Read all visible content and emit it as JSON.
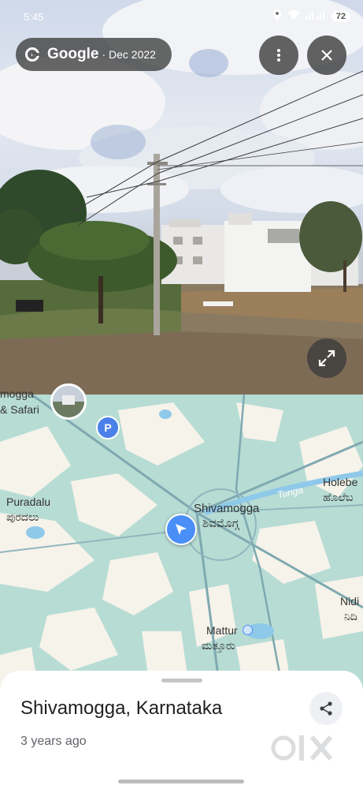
{
  "status_bar": {
    "time": "5:45",
    "battery": "72"
  },
  "street_view": {
    "brand": "Google",
    "date": "· Dec 2022",
    "more_icon": "more-vert-icon",
    "close_icon": "close-icon",
    "expand_icon": "expand-icon"
  },
  "map": {
    "labels": {
      "safari_top": "mogga",
      "safari": "& Safari",
      "puradalu_en": "Puradalu",
      "puradalu_kn": "ಪುರದಲು",
      "shivamogga_en": "Shivamogga",
      "shivamogga_kn": "ಶಿವಮೊಗ್ಗ",
      "tunga": "Tunga",
      "holebe_en": "Holebe",
      "holebe_kn": "ಹೊಲೆಬ",
      "nidi_en": "Nidi",
      "nidi_kn": "ನಿದಿ",
      "mattur_en": "Mattur",
      "mattur_kn": "ಮತ್ತೂರು"
    },
    "parking_label": "P",
    "colors": {
      "water": "#b7dcd4",
      "land": "#f6f3ea",
      "road": "#8fb7be",
      "accent": "#4a8ef7"
    }
  },
  "place": {
    "title": "Shivamogga, Karnataka",
    "time_ago": "3 years ago",
    "share_icon": "share-icon"
  },
  "watermark": {
    "text": "OLX"
  }
}
